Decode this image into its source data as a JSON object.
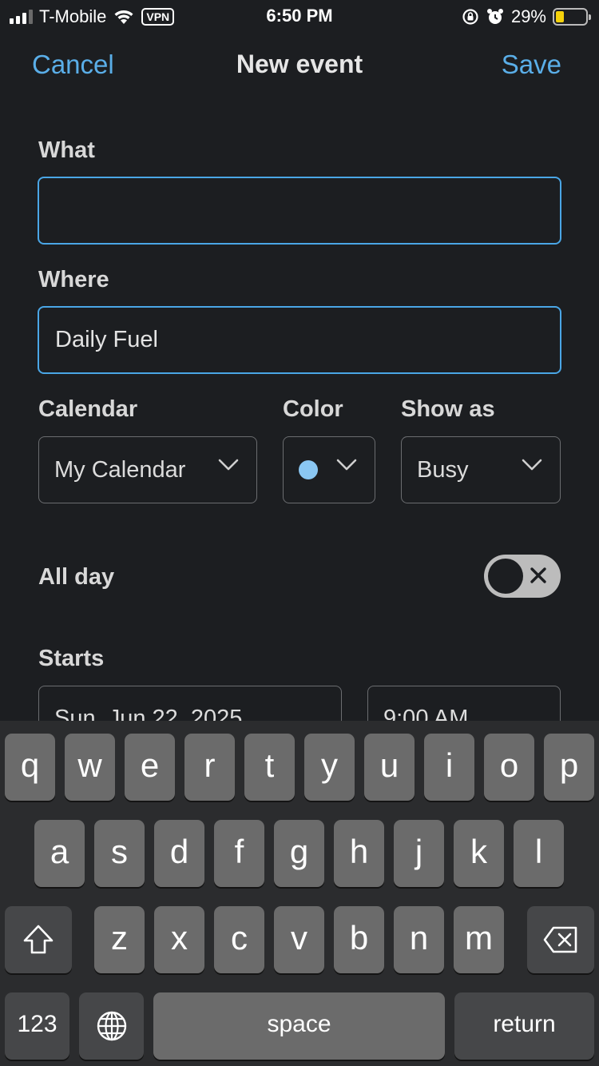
{
  "status": {
    "carrier": "T-Mobile",
    "vpn": "VPN",
    "time": "6:50 PM",
    "battery": "29%",
    "battery_level": 0.29
  },
  "nav": {
    "cancel": "Cancel",
    "title": "New event",
    "save": "Save"
  },
  "form": {
    "what_label": "What",
    "what_value": "",
    "where_label": "Where",
    "where_value": "Daily Fuel",
    "calendar_label": "Calendar",
    "calendar_value": "My Calendar",
    "color_label": "Color",
    "color_value": "#8ac7f3",
    "showas_label": "Show as",
    "showas_value": "Busy",
    "allday_label": "All day",
    "allday_on": false,
    "starts_label": "Starts",
    "starts_date": "Sun, Jun 22, 2025",
    "starts_time": "9:00 AM"
  },
  "keyboard": {
    "row1": [
      "q",
      "w",
      "e",
      "r",
      "t",
      "y",
      "u",
      "i",
      "o",
      "p"
    ],
    "row2": [
      "a",
      "s",
      "d",
      "f",
      "g",
      "h",
      "j",
      "k",
      "l"
    ],
    "row3": [
      "z",
      "x",
      "c",
      "v",
      "b",
      "n",
      "m"
    ],
    "numbers": "123",
    "space": "space",
    "return": "return"
  },
  "colors": {
    "accent": "#5aaee8",
    "background": "#1c1e21",
    "key": "#6b6b6b",
    "key_mod": "#464749"
  }
}
